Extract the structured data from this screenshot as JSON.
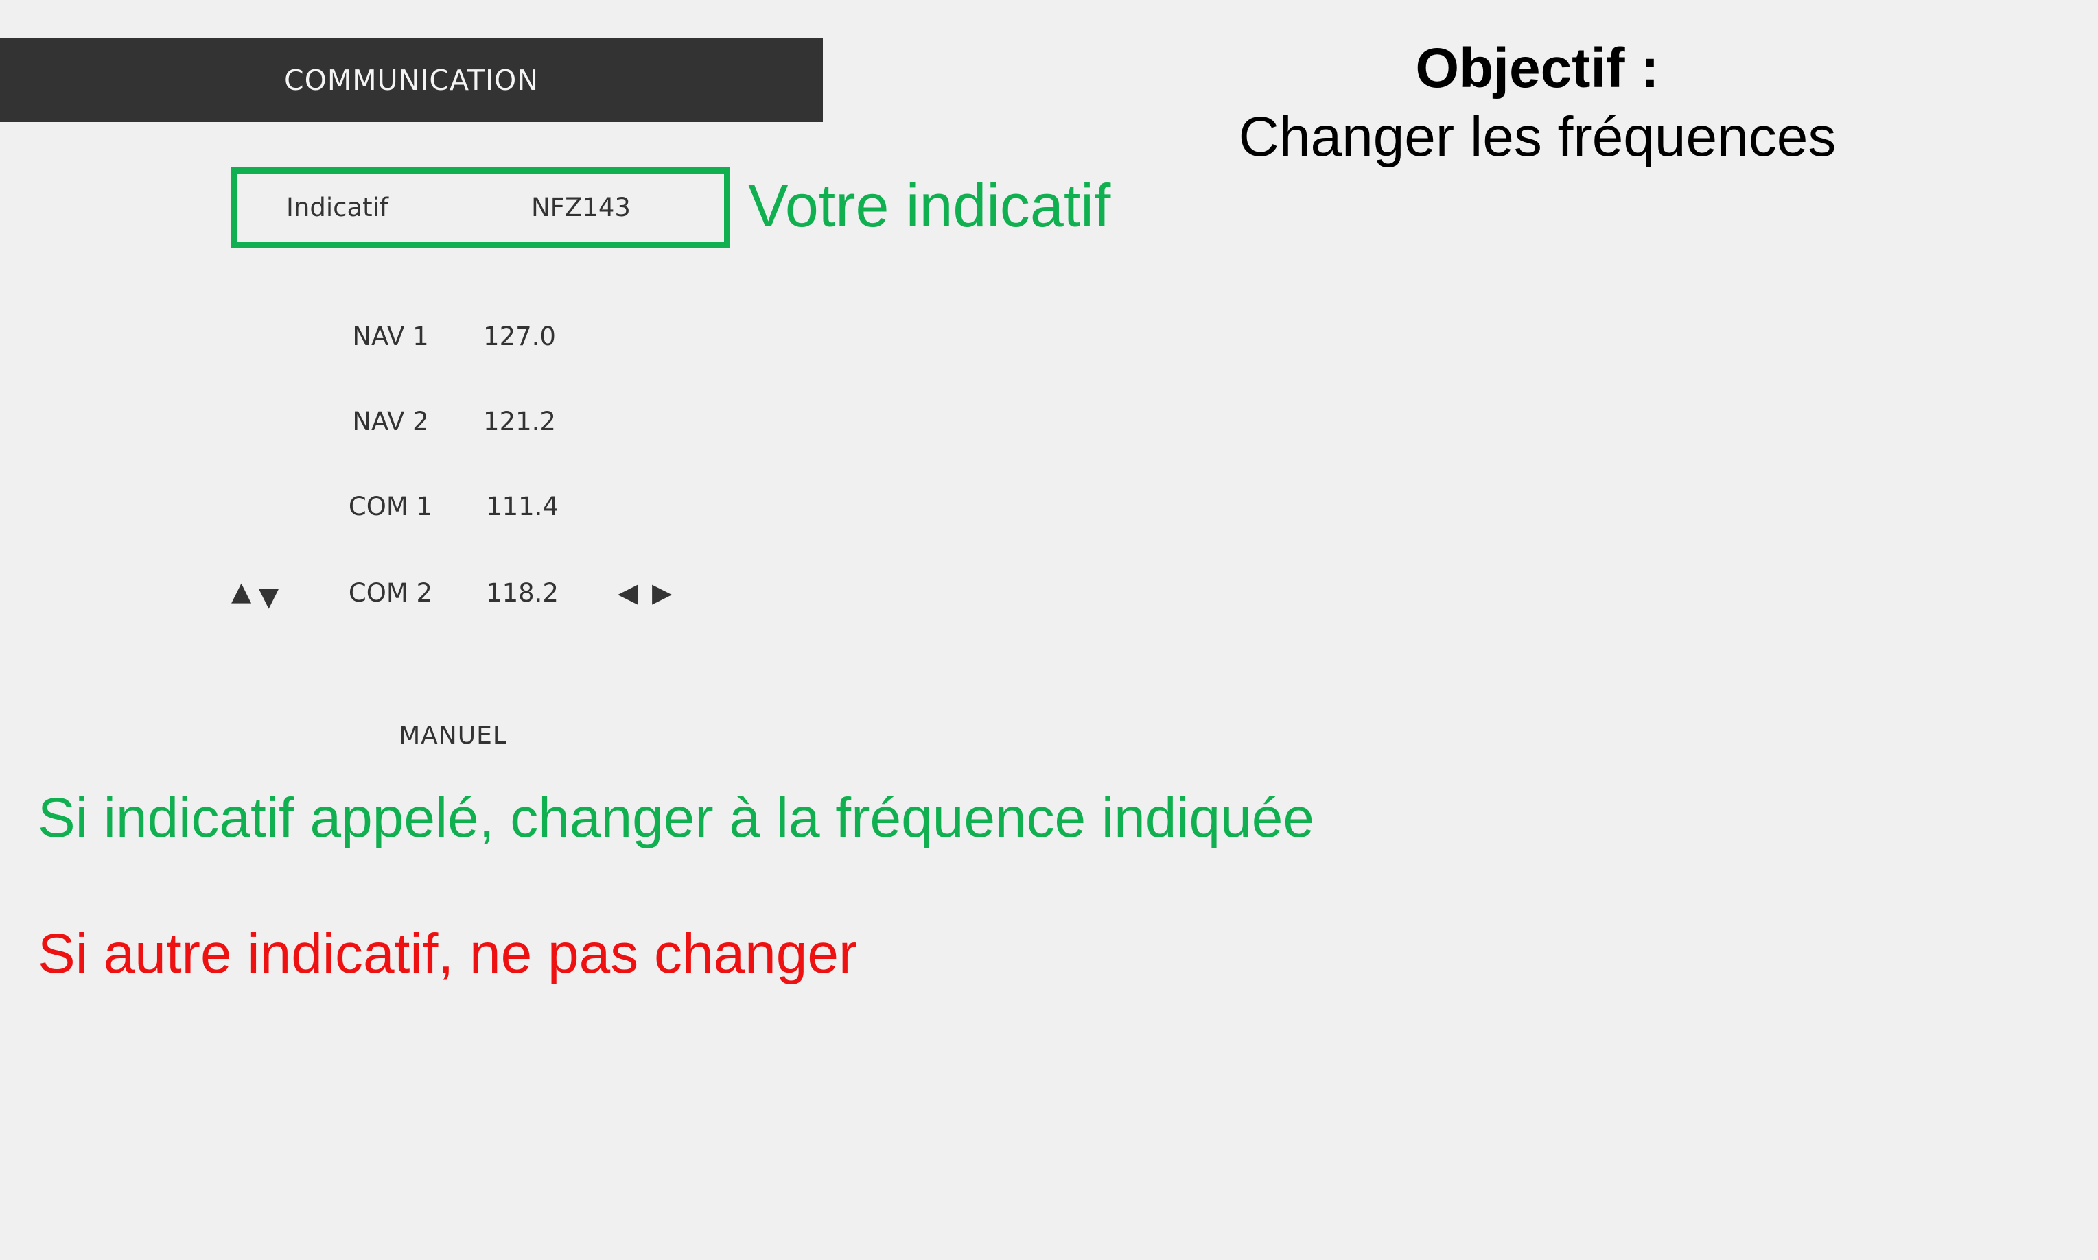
{
  "header": {
    "title": "COMMUNICATION"
  },
  "objective": {
    "title": "Objectif :",
    "subtitle": "Changer les fréquences"
  },
  "callsign": {
    "label": "Indicatif",
    "value": "NFZ143",
    "annotation": "Votre indicatif"
  },
  "frequencies": [
    {
      "label": "NAV 1",
      "value": "127.0"
    },
    {
      "label": "NAV 2",
      "value": "121.2"
    },
    {
      "label": "COM 1",
      "value": "111.4"
    },
    {
      "label": "COM 2",
      "value": "118.2"
    }
  ],
  "controls": {
    "up_icon": "▲",
    "down_icon": "▼",
    "left_icon": "◀",
    "right_icon": "▶"
  },
  "mode": {
    "label": "MANUEL"
  },
  "instructions": {
    "green": "Si indicatif appelé, changer à la fréquence indiquée",
    "red": "Si autre indicatif, ne pas changer"
  },
  "colors": {
    "header_bg": "#333333",
    "highlight_green": "#10b050",
    "warning_red": "#ee1111",
    "background": "#f0f0f0"
  }
}
